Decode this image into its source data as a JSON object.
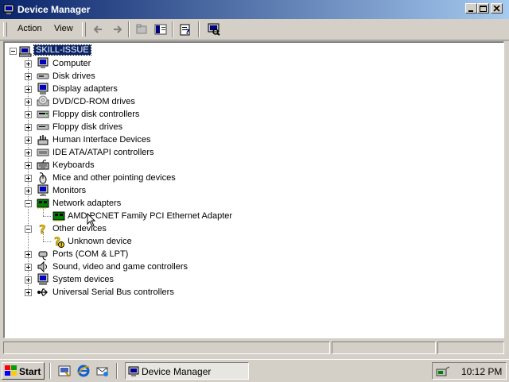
{
  "window": {
    "title": "Device Manager"
  },
  "menu": {
    "action": "Action",
    "view": "View"
  },
  "tree": {
    "root": "SKILL-ISSUE",
    "nodes": [
      {
        "label": "Computer",
        "icon": "computer-icon",
        "expanded": false
      },
      {
        "label": "Disk drives",
        "icon": "disk-drive-icon",
        "expanded": false
      },
      {
        "label": "Display adapters",
        "icon": "display-adapter-icon",
        "expanded": false
      },
      {
        "label": "DVD/CD-ROM drives",
        "icon": "cdrom-icon",
        "expanded": false
      },
      {
        "label": "Floppy disk controllers",
        "icon": "floppy-controller-icon",
        "expanded": false
      },
      {
        "label": "Floppy disk drives",
        "icon": "floppy-drive-icon",
        "expanded": false
      },
      {
        "label": "Human Interface Devices",
        "icon": "hid-icon",
        "expanded": false
      },
      {
        "label": "IDE ATA/ATAPI controllers",
        "icon": "ide-controller-icon",
        "expanded": false
      },
      {
        "label": "Keyboards",
        "icon": "keyboard-icon",
        "expanded": false
      },
      {
        "label": "Mice and other pointing devices",
        "icon": "mouse-icon",
        "expanded": false
      },
      {
        "label": "Monitors",
        "icon": "monitor-icon",
        "expanded": false
      },
      {
        "label": "Network adapters",
        "icon": "network-adapter-icon",
        "expanded": true
      },
      {
        "label": "AMD PCNET Family PCI Ethernet Adapter",
        "icon": "network-card-icon",
        "child": true
      },
      {
        "label": "Other devices",
        "icon": "question-icon",
        "expanded": true
      },
      {
        "label": "Unknown device",
        "icon": "unknown-device-icon",
        "child": true
      },
      {
        "label": "Ports (COM & LPT)",
        "icon": "port-icon",
        "expanded": false
      },
      {
        "label": "Sound, video and game controllers",
        "icon": "sound-icon",
        "expanded": false
      },
      {
        "label": "System devices",
        "icon": "system-device-icon",
        "expanded": false
      },
      {
        "label": "Universal Serial Bus controllers",
        "icon": "usb-icon",
        "expanded": false
      }
    ]
  },
  "taskbar": {
    "start": "Start",
    "task_title": "Device Manager",
    "clock": "10:12 PM"
  },
  "colors": {
    "titlebar_start": "#0a246a",
    "titlebar_end": "#a6caf0",
    "face": "#d4d0c8",
    "selection": "#0a246a"
  }
}
